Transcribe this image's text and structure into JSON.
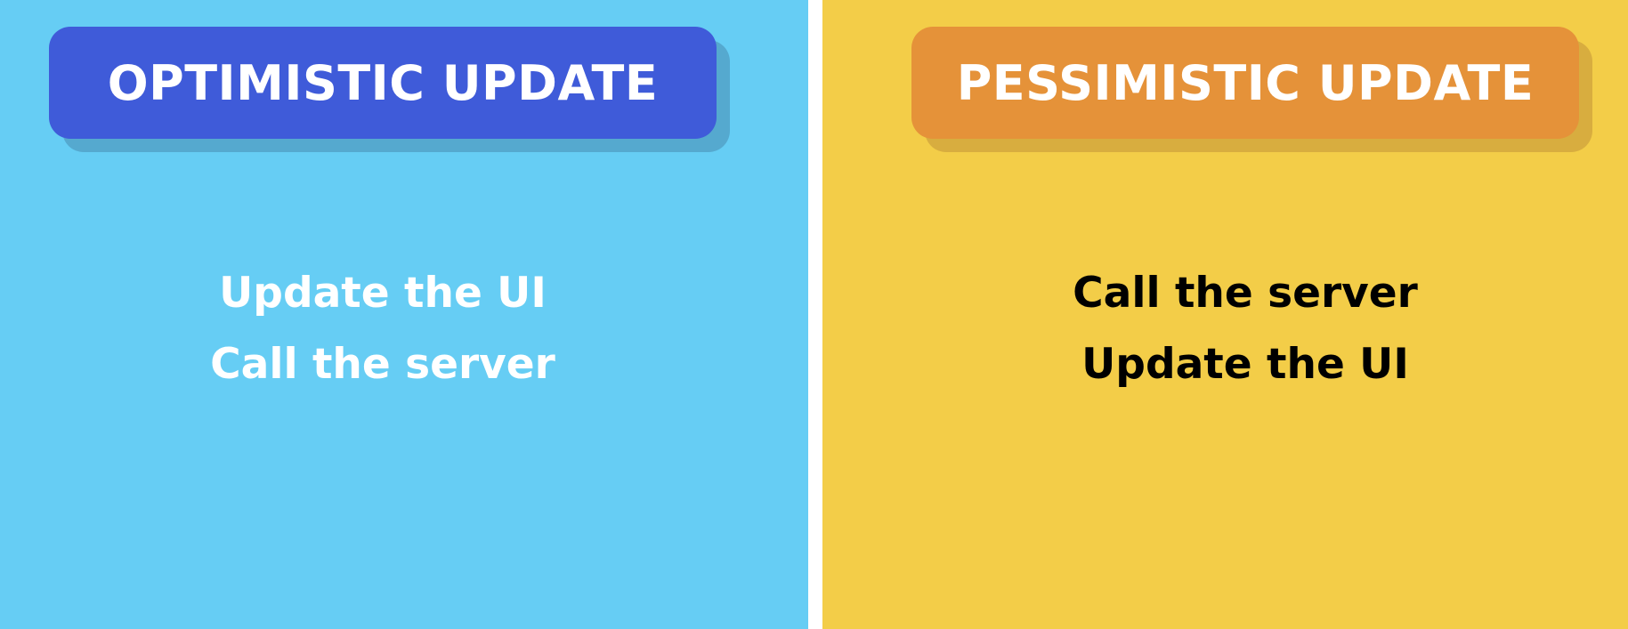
{
  "colors": {
    "left_background": "#66cdf4",
    "left_banner": "#3f5bd9",
    "right_background": "#f3cd48",
    "right_banner": "#e59239",
    "divider": "#ffffff"
  },
  "optimistic": {
    "title": "OPTIMISTIC UPDATE",
    "steps": [
      "Update the UI",
      "Call the server"
    ]
  },
  "pessimistic": {
    "title": "PESSIMISTIC UPDATE",
    "steps": [
      "Call the server",
      "Update the UI"
    ]
  }
}
